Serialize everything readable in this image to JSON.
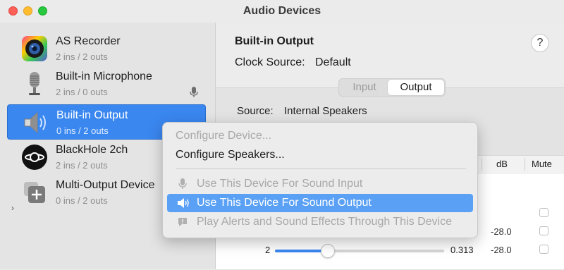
{
  "window": {
    "title": "Audio Devices"
  },
  "sidebar": {
    "devices": [
      {
        "name": "AS Recorder",
        "io": "2 ins / 2 outs",
        "icon": "as-recorder-icon"
      },
      {
        "name": "Built-in Microphone",
        "io": "2 ins / 0 outs",
        "icon": "microphone-icon"
      },
      {
        "name": "Built-in Output",
        "io": "0 ins / 2 outs",
        "icon": "speaker-icon",
        "selected": true
      },
      {
        "name": "BlackHole 2ch",
        "io": "2 ins / 2 outs",
        "icon": "blackhole-icon"
      },
      {
        "name": "Multi-Output Device",
        "io": "0 ins / 2 outs",
        "icon": "multi-output-icon"
      }
    ],
    "disclosure": "›"
  },
  "detail": {
    "title": "Built-in Output",
    "help": "?",
    "clock_label": "Clock Source:",
    "clock_value": "Default",
    "tabs": {
      "input": "Input",
      "output": "Output",
      "selected": "Output"
    },
    "source_label": "Source:",
    "source_value": "Internal Speakers",
    "table": {
      "headers": {
        "db": "dB",
        "mute": "Mute"
      },
      "rows": [
        {
          "channel": "",
          "value": "",
          "db": "",
          "mute": false
        },
        {
          "channel": "",
          "value": "",
          "db": "-28.0",
          "mute": false
        },
        {
          "channel": "2",
          "value": "0.313",
          "db": "-28.0",
          "mute": false,
          "level": 0.313
        }
      ]
    }
  },
  "context_menu": {
    "items": [
      {
        "label": "Configure Device...",
        "disabled": true
      },
      {
        "label": "Configure Speakers...",
        "disabled": false
      },
      {
        "label": "Use This Device For Sound Input",
        "disabled": true,
        "icon": "microphone-icon"
      },
      {
        "label": "Use This Device For Sound Output",
        "disabled": false,
        "highlighted": true,
        "icon": "speaker-icon"
      },
      {
        "label": "Play Alerts and Sound Effects Through This Device",
        "disabled": true,
        "icon": "alert-icon"
      }
    ]
  },
  "colors": {
    "accent": "#3a87f0",
    "highlight": "#5aa0f5"
  }
}
